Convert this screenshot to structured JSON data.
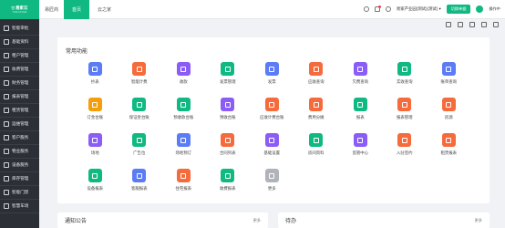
{
  "brand": {
    "logo": "易家云",
    "logo_sub": "YIJIA CLOUD",
    "name": "易匠商"
  },
  "topbar": {
    "tabs": [
      {
        "label": "首页",
        "active": true
      },
      {
        "label": "云之家",
        "active": false
      }
    ],
    "org": "易家产业园(测试)(测试) ▾",
    "switch": "切换单据",
    "user": "操作中"
  },
  "sidebar": {
    "items": [
      "智能审批",
      "基础资料",
      "租户管理",
      "收费管理",
      "财务管理",
      "报表管理",
      "租赁管理",
      "运维管理",
      "客户服务",
      "物业服务",
      "设备服务",
      "库存管理",
      "智能门禁",
      "智慧车场"
    ]
  },
  "card": {
    "title": "常用功能"
  },
  "apps": [
    [
      {
        "label": "抄表",
        "color": "#5b7cf5"
      },
      {
        "label": "智能计费",
        "color": "#f56b3c"
      },
      {
        "label": "收款",
        "color": "#8b5cf6"
      },
      {
        "label": "发票管理",
        "color": "#10b981"
      },
      {
        "label": "发票",
        "color": "#5b7cf5"
      },
      {
        "label": "应收查询",
        "color": "#f56b3c"
      },
      {
        "label": "欠费查询",
        "color": "#8b5cf6"
      },
      {
        "label": "实收查询",
        "color": "#10b981"
      },
      {
        "label": "账单查询",
        "color": "#5b7cf5"
      }
    ],
    [
      {
        "label": "订金台账",
        "color": "#f59e0b"
      },
      {
        "label": "保证金台账",
        "color": "#10b981"
      },
      {
        "label": "预收款台账",
        "color": "#10b981"
      },
      {
        "label": "预收台账",
        "color": "#8b5cf6"
      },
      {
        "label": "应收计费台账",
        "color": "#f56b3c"
      },
      {
        "label": "费用分摊",
        "color": "#f56b3c"
      },
      {
        "label": "报表",
        "color": "#10b981"
      },
      {
        "label": "报表管理",
        "color": "#f56b3c"
      },
      {
        "label": "房源",
        "color": "#f56b3c"
      }
    ],
    [
      {
        "label": "场地",
        "color": "#8b5cf6"
      },
      {
        "label": "广告位",
        "color": "#10b981"
      },
      {
        "label": "场地预订",
        "color": "#5b7cf5"
      },
      {
        "label": "合同列表",
        "color": "#f56b3c"
      },
      {
        "label": "基础设置",
        "color": "#8b5cf6"
      },
      {
        "label": "房间资料",
        "color": "#10b981"
      },
      {
        "label": "监管中心",
        "color": "#8b5cf6"
      },
      {
        "label": "入驻签约",
        "color": "#f56b3c"
      },
      {
        "label": "租赁报表",
        "color": "#f56b3c"
      }
    ],
    [
      {
        "label": "设备报表",
        "color": "#10b981"
      },
      {
        "label": "客服报表",
        "color": "#5b7cf5"
      },
      {
        "label": "住宅报表",
        "color": "#f56b3c"
      },
      {
        "label": "收费报表",
        "color": "#10b981"
      },
      {
        "label": "更多",
        "color": "#b0b3b8"
      }
    ]
  ],
  "panels": {
    "notice": {
      "title": "通知公告",
      "more": "更多"
    },
    "todo": {
      "title": "待办",
      "more": "更多"
    }
  }
}
